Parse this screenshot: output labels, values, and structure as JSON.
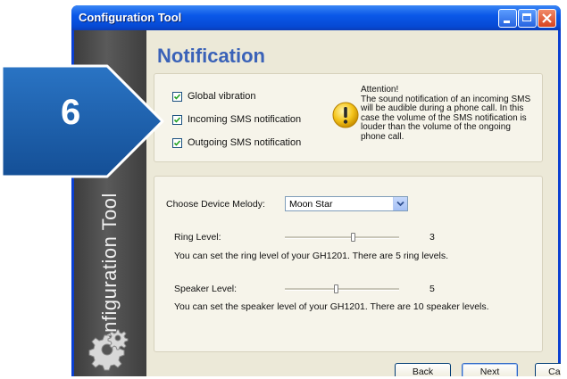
{
  "window": {
    "title": "Configuration Tool"
  },
  "sidebar": {
    "text": "Configuration Tool"
  },
  "page": {
    "title": "Notification"
  },
  "step": {
    "number": "6"
  },
  "notifications": {
    "options": [
      {
        "label": "Global vibration",
        "checked": true
      },
      {
        "label": "Incoming SMS notification",
        "checked": true
      },
      {
        "label": "Outgoing SMS notification",
        "checked": true
      }
    ],
    "attention": {
      "heading": "Attention!",
      "text": "The sound notification of an incoming SMS will be audible during a phone call. In this case the volume of the SMS notification is louder than the volume of the ongoing phone call."
    }
  },
  "sound": {
    "melody_label": "Choose Device Melody:",
    "melody_value": "Moon Star",
    "ring_label": "Ring Level:",
    "ring_value": "3",
    "ring_level_fraction": 0.6,
    "ring_help": "You can set the ring level of your GH1201. There are 5 ring levels.",
    "speaker_label": "Speaker Level:",
    "speaker_value": "5",
    "speaker_level_fraction": 0.45,
    "speaker_help": "You can set the speaker level of your GH1201. There are 10 speaker levels."
  },
  "buttons": {
    "back": "Back",
    "next": "Next",
    "cancel": "Cancel"
  },
  "colors": {
    "accent": "#3a62b8",
    "badge": "#1b5fae",
    "titlebar": "#0a58e8"
  }
}
